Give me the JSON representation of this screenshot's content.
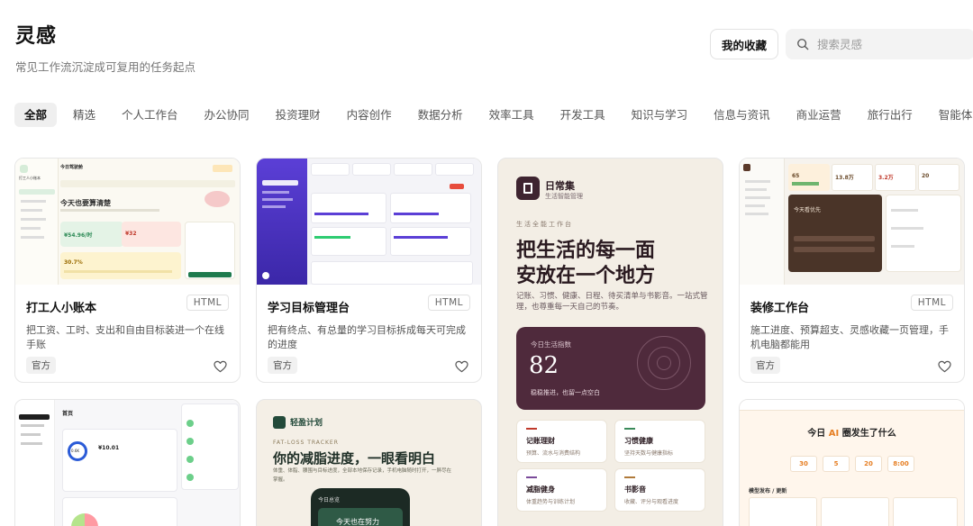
{
  "header": {
    "title": "灵感",
    "subtitle": "常见工作流沉淀成可复用的任务起点",
    "favorites_label": "我的收藏",
    "search_placeholder": "搜索灵感"
  },
  "tabs": [
    "全部",
    "精选",
    "个人工作台",
    "办公协同",
    "投资理财",
    "内容创作",
    "数据分析",
    "效率工具",
    "开发工具",
    "知识与学习",
    "信息与资讯",
    "商业运营",
    "旅行出行",
    "智能体能力"
  ],
  "cards": [
    {
      "title": "打工人小账本",
      "format": "HTML",
      "description": "把工资、工时、支出和自由目标装进一个在线手账",
      "badge": "官方",
      "thumb": {
        "heading": "今天也要算清楚",
        "stat1": "¥54.96/时",
        "stat2": "¥32",
        "stat3": "30.7%",
        "top": "今日驾驶舱",
        "app": "打工人小账本"
      }
    },
    {
      "title": "学习目标管理台",
      "format": "HTML",
      "description": "把有终点、有总量的学习目标拆成每天可完成的进度",
      "badge": "",
      "thumb": {}
    },
    {
      "title": "日常集",
      "format": "",
      "description": "",
      "badge": "",
      "thumb": {
        "brand": "日常集",
        "brand_sub": "生活智能管理",
        "kicker": "生活全能工作台",
        "headline1": "把生活的每一面",
        "headline2": "安放在一个地方",
        "lead1": "记账、习惯、健康、日程、待买清单与书影音。一站式管",
        "lead2": "理，也尊重每一天自己的节奏。",
        "score_label": "今日生活指数",
        "score": "82",
        "score_note": "稳稳推进，也留一点空白",
        "tiles": [
          {
            "title": "记账理财",
            "sub": "预算、流水与消费结构"
          },
          {
            "title": "习惯健康",
            "sub": "坚持天数与健康指标"
          },
          {
            "title": "减脂健身",
            "sub": "体重趋势与训练计划"
          },
          {
            "title": "书影音",
            "sub": "收藏、评分与观看进度"
          }
        ]
      }
    },
    {
      "title": "装修工作台",
      "format": "HTML",
      "description": "施工进度、预算超支、灵感收藏一页管理，手机电脑都能用",
      "badge": "官方",
      "thumb": {
        "stat1": "65",
        "stat2": "13.8万",
        "stat3": "3.2万",
        "stat4": "20",
        "dark": "今天看优先"
      }
    },
    {
      "title": "",
      "format": "",
      "description": "",
      "badge": "",
      "thumb": {
        "heading": "首页",
        "amount": "¥10.01",
        "ratio": "0.6K"
      }
    },
    {
      "title": "",
      "format": "",
      "description": "",
      "badge": "",
      "thumb": {
        "brand": "轻盈计划",
        "kicker": "FAT-LOSS TRACKER",
        "headline": "你的减脂进度，一眼看明白",
        "lead1": "体重、体脂、腰围与目标进度，全部本地保存记录，手机电脑随时打开，一屏尽在",
        "lead2": "掌握。",
        "phone_title": "今日总览",
        "phone_text": "今天也在努力"
      }
    },
    {
      "title": "",
      "format": "",
      "description": "",
      "badge": "",
      "thumb": {
        "headline_a": "今日 ",
        "headline_ai": "AI",
        "headline_b": " 圈发生了什么",
        "stats": [
          "30",
          "5",
          "20",
          "8:00"
        ],
        "section": "模型发布 / 更新"
      }
    }
  ]
}
